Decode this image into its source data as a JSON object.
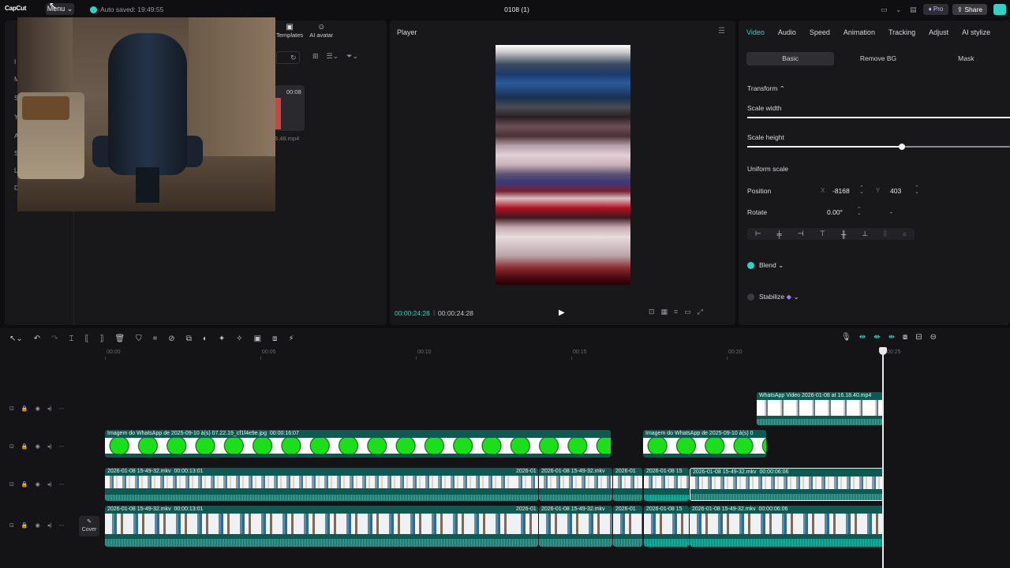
{
  "topbar": {
    "logo": "CapCut",
    "menu_label": "Menu",
    "autosave": "Auto saved: 19:49:55",
    "project_title": "0108 (1)",
    "pro_label": "Pro",
    "share_label": "Share"
  },
  "left_panel": {
    "tools": [
      {
        "label": "Templates",
        "icon": "templates-icon"
      },
      {
        "label": "AI avatar",
        "icon": "ai-avatar-icon"
      }
    ],
    "media_item": {
      "duration": "00:08",
      "name": "3.48.mp4"
    }
  },
  "player": {
    "title": "Player",
    "time_current": "00:00:24:28",
    "time_total": "00:00:24:28"
  },
  "inspector": {
    "tabs": [
      "Video",
      "Audio",
      "Speed",
      "Animation",
      "Tracking",
      "Adjust",
      "AI stylize"
    ],
    "active_tab": "Video",
    "subtabs": [
      "Basic",
      "Remove BG",
      "Mask"
    ],
    "active_subtab": "Basic",
    "transform_label": "Transform",
    "scale_width_label": "Scale width",
    "scale_width_value": 1.0,
    "scale_height_label": "Scale height",
    "scale_height_value": 0.59,
    "uniform_scale_label": "Uniform scale",
    "position_label": "Position",
    "pos_x_axis": "X",
    "pos_x": "-8168",
    "pos_y_axis": "Y",
    "pos_y": "403",
    "rotate_label": "Rotate",
    "rotate_value": "0.00°",
    "rotate_extra": "-",
    "blend_label": "Blend",
    "stabilize_label": "Stabilize",
    "colors": {
      "accent": "#2bd4c4"
    }
  },
  "timeline": {
    "ticks": [
      "00:00",
      "00:05",
      "00:10",
      "00:15",
      "00:20",
      "00:25"
    ],
    "cover_label": "Cover",
    "clips": {
      "wa_video": "WhatsApp Video 2026-01-08 at 16.18.40.mp4",
      "img1_name": "Imagem do WhatsApp de 2025-09-10 à(s) 07.22.19_cf1f4e9e.jpg",
      "img1_dur": "00:00:16:07",
      "img2_name": "Imagem do WhatsApp de 2025-09-10 à(s) 0",
      "v1_name": "2026-01-08 15-49-32.mkv",
      "v1_dur": "00:00:13:01",
      "v2_name": "2026-01",
      "v3_name": "2026-01-08 15-49-32.mkv",
      "v4_name": "2026-01",
      "v5_name": "2026-01-08 15",
      "v6_name": "2026-01-08 15-49-32.mkv",
      "v6_dur": "00:00:06:06"
    }
  }
}
